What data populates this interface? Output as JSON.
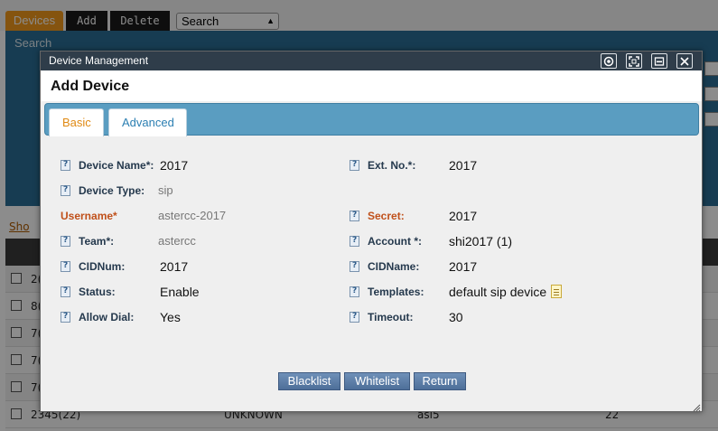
{
  "toolbar": {
    "devices_label": "Devices",
    "add_label": "Add",
    "delete_label": "Delete",
    "search_value": "Search"
  },
  "search_panel": {
    "title": "Search"
  },
  "show_link": "Sho",
  "grid": {
    "rows": [
      {
        "c1": "2(",
        "c2": "",
        "c3": "",
        "c4": ""
      },
      {
        "c1": "8(",
        "c2": "",
        "c3": "",
        "c4": ""
      },
      {
        "c1": "7(",
        "c2": "",
        "c3": "",
        "c4": ""
      },
      {
        "c1": "7(",
        "c2": "",
        "c3": "",
        "c4": ""
      },
      {
        "c1": "7(",
        "c2": "",
        "c3": "",
        "c4": ""
      },
      {
        "c1": "2345(22)",
        "c2": "UNKNOWN",
        "c3": "asi5",
        "c4": "22"
      }
    ]
  },
  "modal": {
    "window_title": "Device Management",
    "heading": "Add Device",
    "tabs": [
      {
        "label": "Basic",
        "active": true
      },
      {
        "label": "Advanced",
        "active": false
      }
    ],
    "fields_left": [
      {
        "label": "Device Name*:",
        "value": "2017",
        "dim": false,
        "required": false
      },
      {
        "label": "Device Type:",
        "value": "sip",
        "dim": true,
        "required": false
      },
      {
        "label": "Username*",
        "value": "astercc-2017",
        "dim": true,
        "required": true
      },
      {
        "label": "Team*:",
        "value": "astercc",
        "dim": true,
        "required": false
      },
      {
        "label": "CIDNum:",
        "value": "2017",
        "dim": false,
        "required": false
      },
      {
        "label": "Status:",
        "value": "Enable",
        "dim": false,
        "required": false
      },
      {
        "label": "Allow Dial:",
        "value": "Yes",
        "dim": false,
        "required": false
      }
    ],
    "fields_right": [
      {
        "label": "Ext. No.*:",
        "value": "2017",
        "required": false
      },
      {
        "label": "Secret:",
        "value": "2017",
        "required": true
      },
      {
        "label": "Account *:",
        "value": "shi2017 (1)",
        "required": false
      },
      {
        "label": "CIDName:",
        "value": "2017",
        "required": false
      },
      {
        "label": "Templates:",
        "value": "default sip device",
        "required": false
      },
      {
        "label": "Timeout:",
        "value": "30",
        "required": false
      }
    ],
    "buttons": {
      "blacklist": "Blacklist",
      "whitelist": "Whitelist",
      "return": "Return"
    }
  },
  "colors": {
    "tab_bar": "#5a9dc1",
    "titlebar": "#2f3d4a",
    "active_tab_text": "#e08a14",
    "required_label": "#c0501a",
    "button": "#5b7ea8"
  }
}
